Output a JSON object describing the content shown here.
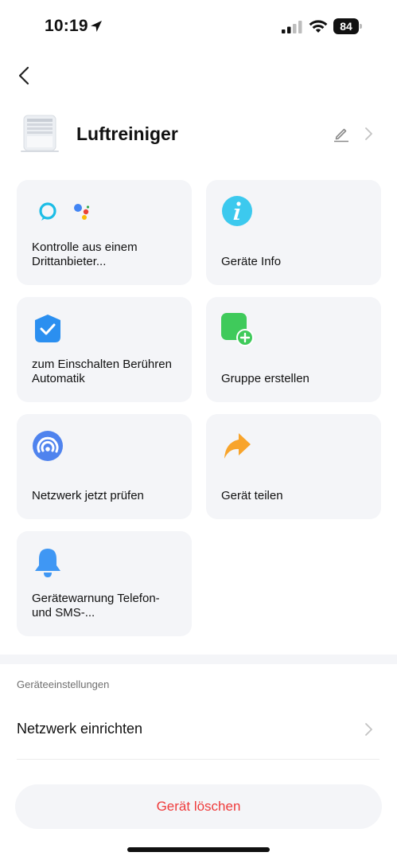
{
  "status_bar": {
    "time": "10:19",
    "battery": "84"
  },
  "device": {
    "name": "Luftreiniger"
  },
  "cards": [
    {
      "label": "Kontrolle aus einem Drittanbieter...",
      "icons": [
        "alexa-icon",
        "google-assistant-icon"
      ]
    },
    {
      "label": "Geräte Info",
      "icons": [
        "info-icon"
      ]
    },
    {
      "label": "zum Einschalten Berühren Automatik",
      "icons": [
        "tap-to-run-icon"
      ]
    },
    {
      "label": "Gruppe erstellen",
      "icons": [
        "create-group-icon"
      ]
    },
    {
      "label": "Netzwerk jetzt prüfen",
      "icons": [
        "network-check-icon"
      ]
    },
    {
      "label": "Gerät teilen",
      "icons": [
        "share-icon"
      ]
    },
    {
      "label": "Gerätewarnung Telefon- und SMS-...",
      "icons": [
        "bell-icon"
      ]
    }
  ],
  "settings": {
    "section_title": "Geräteeinstellungen",
    "network_setup_label": "Netzwerk einrichten"
  },
  "delete_button": {
    "label": "Gerät löschen"
  },
  "colors": {
    "card_bg": "#f4f5f8",
    "delete_text": "#ef3b3b",
    "accent_blue": "#2b8ff0",
    "accent_green": "#3fca5b",
    "accent_orange": "#f8a42b",
    "info_teal": "#3cc9ee"
  }
}
